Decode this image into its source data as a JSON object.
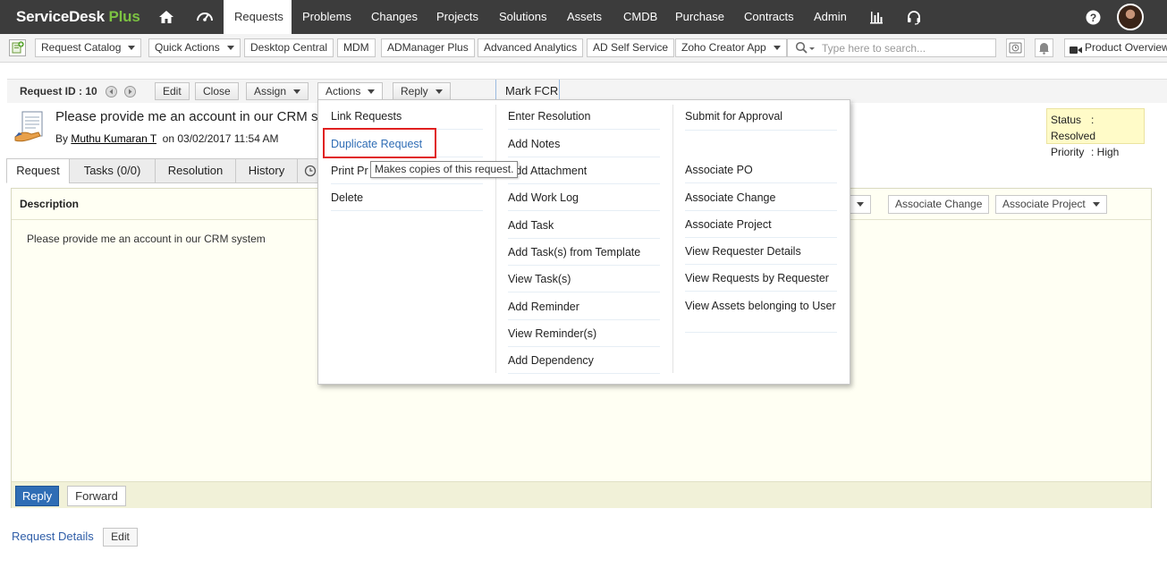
{
  "app": {
    "brand_name": "ServiceDesk",
    "brand_suffix": "Plus",
    "brand_accent": "#7cc242"
  },
  "topnav": {
    "items": [
      {
        "label": "Requests",
        "active": true
      },
      {
        "label": "Problems"
      },
      {
        "label": "Changes"
      },
      {
        "label": "Projects"
      },
      {
        "label": "Solutions"
      },
      {
        "label": "Assets"
      },
      {
        "label": "CMDB"
      },
      {
        "label": "Purchase"
      },
      {
        "label": "Contracts"
      },
      {
        "label": "Admin"
      }
    ],
    "icons": [
      "home-icon",
      "dashboard-icon",
      "reports-icon",
      "headset-icon",
      "help-icon",
      "avatar"
    ]
  },
  "toolbar": {
    "request_catalog": "Request Catalog",
    "quick_actions": "Quick Actions",
    "links": [
      "Desktop Central",
      "MDM",
      "ADManager Plus",
      "Advanced Analytics",
      "AD Self Service",
      "Zoho Creator App"
    ],
    "search_placeholder": "Type here to search...",
    "product_overview": "Product Overview"
  },
  "request": {
    "id_label": "Request ID : 10",
    "edit": "Edit",
    "close": "Close",
    "assign": "Assign",
    "actions": "Actions",
    "reply": "Reply",
    "mark_fcr": "Mark FCR",
    "subject": "Please provide me an account in our CRM sy",
    "by": "By",
    "requester": "Muthu Kumaran T",
    "on": "on",
    "date": "03/02/2017 11:54 AM",
    "status_label": "Status",
    "status_value": ": Resolved",
    "priority_label": "Priority",
    "priority_value": ": High"
  },
  "tabs": [
    "Request",
    "Tasks (0/0)",
    "Resolution",
    "History"
  ],
  "panel": {
    "description_label": "Description",
    "description_text": "Please provide me an account in our CRM system",
    "partial_btn": "s",
    "associate_change": "Associate Change",
    "associate_project": "Associate Project",
    "reply": "Reply",
    "forward": "Forward"
  },
  "request_details": {
    "label": "Request Details",
    "edit": "Edit"
  },
  "actions_menu": {
    "col1": [
      "Link Requests",
      "Duplicate Request",
      "Print Pr",
      "Delete"
    ],
    "col2": [
      "Enter Resolution",
      "Add Notes",
      "Add Attachment",
      "Add Work Log",
      "Add Task",
      "Add Task(s) from Template",
      "View Task(s)",
      "Add Reminder",
      "View Reminder(s)",
      "Add Dependency"
    ],
    "col3": [
      "Submit for Approval",
      "Associate PO",
      "Associate Change",
      "Associate Project",
      "View Requester Details",
      "View Requests by Requester",
      "View Assets belonging to User"
    ],
    "tooltip": "Makes copies of this request.",
    "highlight_color": "#e02020",
    "link_color": "#2f6db5"
  }
}
